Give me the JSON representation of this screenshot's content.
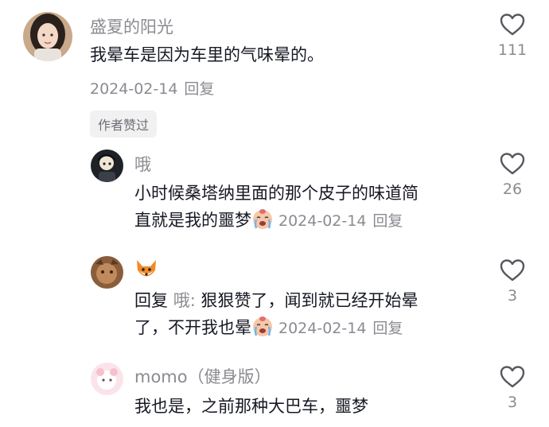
{
  "comments": [
    {
      "username": "盛夏的阳光",
      "text": "我晕车是因为车里的气味晕的。",
      "date": "2024-02-14",
      "reply_label": "回复",
      "likes": "111",
      "badge": "作者赞过",
      "avatar": "woman-avatar"
    },
    {
      "username": "哦",
      "text_line1": "小时候桑塔纳里面的那个皮子的味道简",
      "text_line2": "直就是我的噩梦",
      "date": "2024-02-14",
      "reply_label": "回复",
      "likes": "26",
      "emoji": "crying-emoji",
      "avatar": "dark-character-avatar"
    },
    {
      "username_icon": "fox-icon",
      "reply_prefix": "回复",
      "reply_to": "哦",
      "text_line1": "狠狠赞了，闻到就已经开始晕",
      "text_line2": "了，不开我也晕",
      "date": "2024-02-14",
      "reply_label": "回复",
      "likes": "3",
      "emoji": "crying-emoji",
      "avatar": "brown-avatar"
    },
    {
      "username": "momo（健身版）",
      "text": "我也是，之前那种大巴车，噩梦",
      "likes": "3",
      "avatar": "pink-avatar"
    }
  ]
}
